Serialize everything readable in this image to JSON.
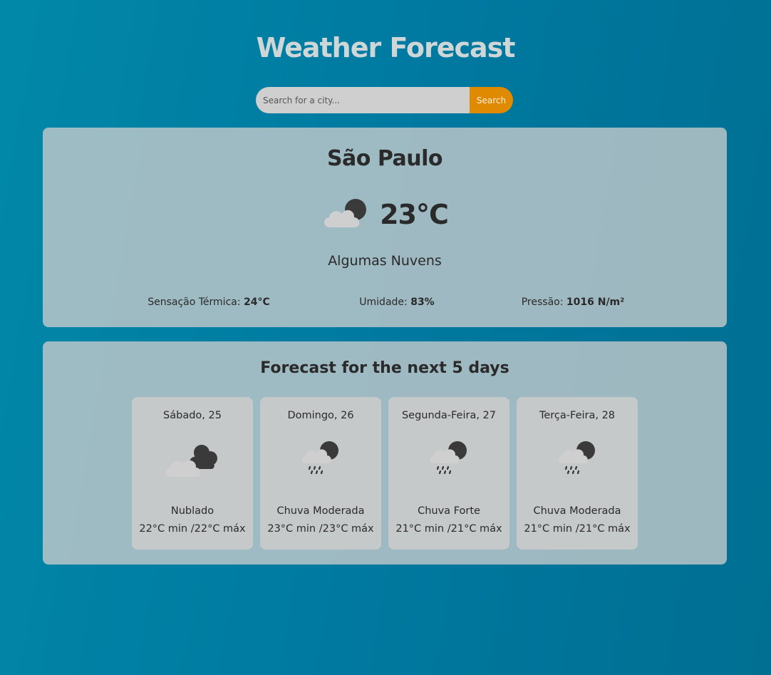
{
  "header": {
    "title": "Weather Forecast"
  },
  "search": {
    "placeholder": "Search for a city...",
    "button_label": "Search"
  },
  "current": {
    "city": "São Paulo",
    "temperature": "23°C",
    "icon": "partly-cloudy-night-icon",
    "condition": "Algumas Nuvens",
    "feels_like_label": "Sensação Térmica:",
    "feels_like_value": "24°C",
    "humidity_label": "Umidade:",
    "humidity_value": "83%",
    "pressure_label": "Pressão:",
    "pressure_value": "1016 N/m²"
  },
  "forecast": {
    "title": "Forecast for the next 5 days",
    "days": [
      {
        "date": "Sábado, 25",
        "icon": "cloudy-night-icon",
        "condition": "Nublado",
        "range": "22°C min /22°C máx"
      },
      {
        "date": "Domingo, 26",
        "icon": "rain-night-icon",
        "condition": "Chuva Moderada",
        "range": "23°C min /23°C máx"
      },
      {
        "date": "Segunda-Feira, 27",
        "icon": "rain-night-icon",
        "condition": "Chuva Forte",
        "range": "21°C min /21°C máx"
      },
      {
        "date": "Terça-Feira, 28",
        "icon": "rain-night-icon",
        "condition": "Chuva Moderada",
        "range": "21°C min /21°C máx"
      }
    ]
  },
  "colors": {
    "accent_button": "#e08a00",
    "background_start": "#0188a8",
    "background_end": "#006f92",
    "panel": "#caccc c"
  }
}
